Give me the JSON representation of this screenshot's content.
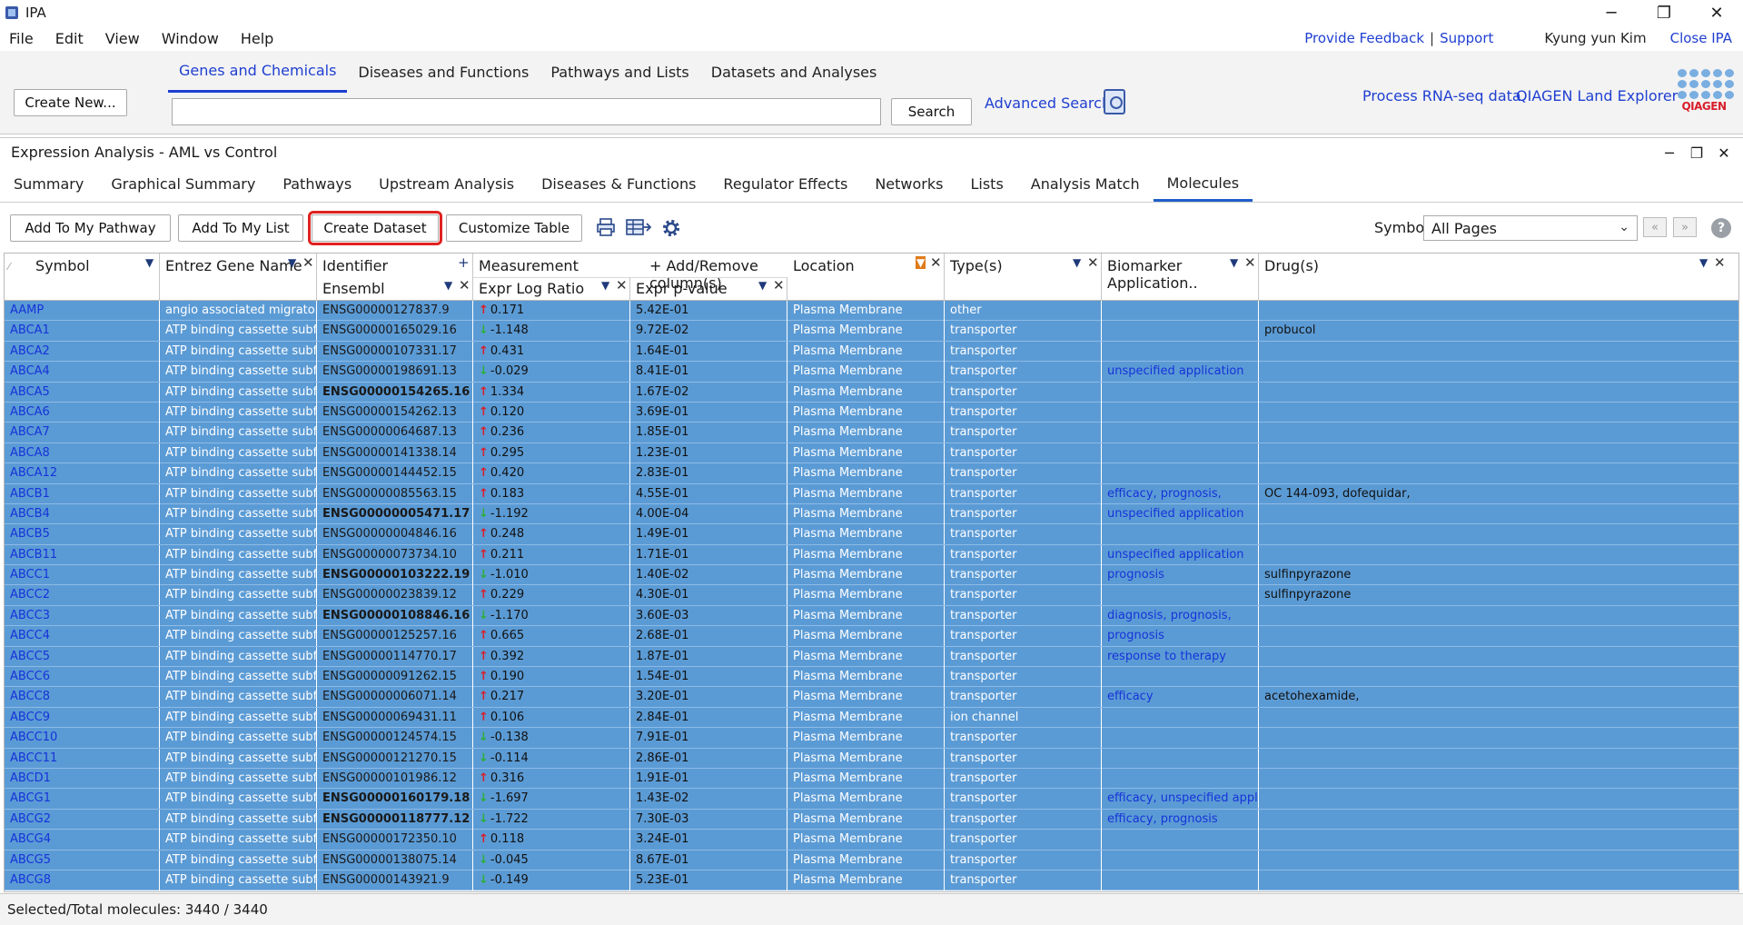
{
  "app": {
    "title": "IPA"
  },
  "window_controls": {
    "minimize": "─",
    "maximize": "❐",
    "close": "✕"
  },
  "menu": [
    "File",
    "Edit",
    "View",
    "Window",
    "Help"
  ],
  "top_links": {
    "feedback": "Provide Feedback",
    "separator": "|",
    "support": "Support",
    "user": "Kyung yun Kim",
    "close": "Close IPA"
  },
  "search": {
    "create_new": "Create New...",
    "tabs": [
      "Genes and Chemicals",
      "Diseases and Functions",
      "Pathways and Lists",
      "Datasets and Analyses"
    ],
    "active_tab": 0,
    "input_value": "",
    "button": "Search",
    "advanced": "Advanced Search",
    "rna_seq": "Process RNA-seq data",
    "land_explorer": "QIAGEN Land Explorer",
    "logo_text": "QIAGEN"
  },
  "panel": {
    "title": "Expression Analysis - AML vs Control",
    "tabs": [
      "Summary",
      "Graphical Summary",
      "Pathways",
      "Upstream Analysis",
      "Diseases & Functions",
      "Regulator Effects",
      "Networks",
      "Lists",
      "Analysis Match",
      "Molecules"
    ],
    "active_tab": "Molecules"
  },
  "toolbar": {
    "add_pathway": "Add To My Pathway",
    "add_list": "Add To My List",
    "create_dataset": "Create Dataset",
    "customize": "Customize Table",
    "symbol_label": "Symbol",
    "pages_value": "All Pages",
    "prev": "«",
    "next": "»",
    "help": "?"
  },
  "table": {
    "headers": {
      "symbol": "Symbol",
      "gene": "Entrez Gene Name",
      "identifier": "Identifier",
      "identifier_sub": "Ensembl",
      "measurement": "Measurement",
      "add_remove": "+ Add/Remove column(s)",
      "ratio_sub": "Expr Log Ratio",
      "pval_sub": "Expr p-value",
      "location": "Location",
      "type": "Type(s)",
      "biomarker": "Biomarker Application..",
      "drugs": "Drug(s)"
    },
    "rows": [
      {
        "symbol": "AAMP",
        "gene": "angio associated migratory cell ...",
        "id": "ENSG00000127837.9",
        "bold": false,
        "dir": "up",
        "ratio": "0.171",
        "pval": "5.42E-01",
        "loc": "Plasma Membrane",
        "type": "other",
        "bio": "",
        "drug": ""
      },
      {
        "symbol": "ABCA1",
        "gene": "ATP binding cassette subfamily ...",
        "id": "ENSG00000165029.16",
        "bold": false,
        "dir": "down",
        "ratio": "-1.148",
        "pval": "9.72E-02",
        "loc": "Plasma Membrane",
        "type": "transporter",
        "bio": "",
        "drug": "probucol"
      },
      {
        "symbol": "ABCA2",
        "gene": "ATP binding cassette subfamily ...",
        "id": "ENSG00000107331.17",
        "bold": false,
        "dir": "up",
        "ratio": "0.431",
        "pval": "1.64E-01",
        "loc": "Plasma Membrane",
        "type": "transporter",
        "bio": "",
        "drug": ""
      },
      {
        "symbol": "ABCA4",
        "gene": "ATP binding cassette subfamily ...",
        "id": "ENSG00000198691.13",
        "bold": false,
        "dir": "down",
        "ratio": "-0.029",
        "pval": "8.41E-01",
        "loc": "Plasma Membrane",
        "type": "transporter",
        "bio": "unspecified application",
        "drug": ""
      },
      {
        "symbol": "ABCA5",
        "gene": "ATP binding cassette subfamily ...",
        "id": "ENSG00000154265.16",
        "bold": true,
        "dir": "up",
        "ratio": "1.334",
        "pval": "1.67E-02",
        "loc": "Plasma Membrane",
        "type": "transporter",
        "bio": "",
        "drug": ""
      },
      {
        "symbol": "ABCA6",
        "gene": "ATP binding cassette subfamily ...",
        "id": "ENSG00000154262.13",
        "bold": false,
        "dir": "up",
        "ratio": "0.120",
        "pval": "3.69E-01",
        "loc": "Plasma Membrane",
        "type": "transporter",
        "bio": "",
        "drug": ""
      },
      {
        "symbol": "ABCA7",
        "gene": "ATP binding cassette subfamily ...",
        "id": "ENSG00000064687.13",
        "bold": false,
        "dir": "up",
        "ratio": "0.236",
        "pval": "1.85E-01",
        "loc": "Plasma Membrane",
        "type": "transporter",
        "bio": "",
        "drug": ""
      },
      {
        "symbol": "ABCA8",
        "gene": "ATP binding cassette subfamily ...",
        "id": "ENSG00000141338.14",
        "bold": false,
        "dir": "up",
        "ratio": "0.295",
        "pval": "1.23E-01",
        "loc": "Plasma Membrane",
        "type": "transporter",
        "bio": "",
        "drug": ""
      },
      {
        "symbol": "ABCA12",
        "gene": "ATP binding cassette subfamily ...",
        "id": "ENSG00000144452.15",
        "bold": false,
        "dir": "up",
        "ratio": "0.420",
        "pval": "2.83E-01",
        "loc": "Plasma Membrane",
        "type": "transporter",
        "bio": "",
        "drug": ""
      },
      {
        "symbol": "ABCB1",
        "gene": "ATP binding cassette subfamily ...",
        "id": "ENSG00000085563.15",
        "bold": false,
        "dir": "up",
        "ratio": "0.183",
        "pval": "4.55E-01",
        "loc": "Plasma Membrane",
        "type": "transporter",
        "bio": "efficacy,   prognosis,",
        "drug": "OC 144-093,   dofequidar,"
      },
      {
        "symbol": "ABCB4",
        "gene": "ATP binding cassette subfamily ...",
        "id": "ENSG00000005471.17",
        "bold": true,
        "dir": "down",
        "ratio": "-1.192",
        "pval": "4.00E-04",
        "loc": "Plasma Membrane",
        "type": "transporter",
        "bio": "unspecified application",
        "drug": ""
      },
      {
        "symbol": "ABCB5",
        "gene": "ATP binding cassette subfamily ...",
        "id": "ENSG00000004846.16",
        "bold": false,
        "dir": "up",
        "ratio": "0.248",
        "pval": "1.49E-01",
        "loc": "Plasma Membrane",
        "type": "transporter",
        "bio": "",
        "drug": ""
      },
      {
        "symbol": "ABCB11",
        "gene": "ATP binding cassette subfamily ...",
        "id": "ENSG00000073734.10",
        "bold": false,
        "dir": "up",
        "ratio": "0.211",
        "pval": "1.71E-01",
        "loc": "Plasma Membrane",
        "type": "transporter",
        "bio": "unspecified application",
        "drug": ""
      },
      {
        "symbol": "ABCC1",
        "gene": "ATP binding cassette subfamily ...",
        "id": "ENSG00000103222.19",
        "bold": true,
        "dir": "down",
        "ratio": "-1.010",
        "pval": "1.40E-02",
        "loc": "Plasma Membrane",
        "type": "transporter",
        "bio": "prognosis",
        "drug": "sulfinpyrazone"
      },
      {
        "symbol": "ABCC2",
        "gene": "ATP binding cassette subfamily ...",
        "id": "ENSG00000023839.12",
        "bold": false,
        "dir": "up",
        "ratio": "0.229",
        "pval": "4.30E-01",
        "loc": "Plasma Membrane",
        "type": "transporter",
        "bio": "",
        "drug": "sulfinpyrazone"
      },
      {
        "symbol": "ABCC3",
        "gene": "ATP binding cassette subfamily ...",
        "id": "ENSG00000108846.16",
        "bold": true,
        "dir": "down",
        "ratio": "-1.170",
        "pval": "3.60E-03",
        "loc": "Plasma Membrane",
        "type": "transporter",
        "bio": "diagnosis,   prognosis,",
        "drug": ""
      },
      {
        "symbol": "ABCC4",
        "gene": "ATP binding cassette subfamily ...",
        "id": "ENSG00000125257.16",
        "bold": false,
        "dir": "up",
        "ratio": "0.665",
        "pval": "2.68E-01",
        "loc": "Plasma Membrane",
        "type": "transporter",
        "bio": "prognosis",
        "drug": ""
      },
      {
        "symbol": "ABCC5",
        "gene": "ATP binding cassette subfamily ...",
        "id": "ENSG00000114770.17",
        "bold": false,
        "dir": "up",
        "ratio": "0.392",
        "pval": "1.87E-01",
        "loc": "Plasma Membrane",
        "type": "transporter",
        "bio": "response to therapy",
        "drug": ""
      },
      {
        "symbol": "ABCC6",
        "gene": "ATP binding cassette subfamily ...",
        "id": "ENSG00000091262.15",
        "bold": false,
        "dir": "up",
        "ratio": "0.190",
        "pval": "1.54E-01",
        "loc": "Plasma Membrane",
        "type": "transporter",
        "bio": "",
        "drug": ""
      },
      {
        "symbol": "ABCC8",
        "gene": "ATP binding cassette subfamily ...",
        "id": "ENSG00000006071.14",
        "bold": false,
        "dir": "up",
        "ratio": "0.217",
        "pval": "3.20E-01",
        "loc": "Plasma Membrane",
        "type": "transporter",
        "bio": "efficacy",
        "drug": "acetohexamide,"
      },
      {
        "symbol": "ABCC9",
        "gene": "ATP binding cassette subfamily ...",
        "id": "ENSG00000069431.11",
        "bold": false,
        "dir": "up",
        "ratio": "0.106",
        "pval": "2.84E-01",
        "loc": "Plasma Membrane",
        "type": "ion channel",
        "bio": "",
        "drug": ""
      },
      {
        "symbol": "ABCC10",
        "gene": "ATP binding cassette subfamily ...",
        "id": "ENSG00000124574.15",
        "bold": false,
        "dir": "down",
        "ratio": "-0.138",
        "pval": "7.91E-01",
        "loc": "Plasma Membrane",
        "type": "transporter",
        "bio": "",
        "drug": ""
      },
      {
        "symbol": "ABCC11",
        "gene": "ATP binding cassette subfamily ...",
        "id": "ENSG00000121270.15",
        "bold": false,
        "dir": "down",
        "ratio": "-0.114",
        "pval": "2.86E-01",
        "loc": "Plasma Membrane",
        "type": "transporter",
        "bio": "",
        "drug": ""
      },
      {
        "symbol": "ABCD1",
        "gene": "ATP binding cassette subfamily ...",
        "id": "ENSG00000101986.12",
        "bold": false,
        "dir": "up",
        "ratio": "0.316",
        "pval": "1.91E-01",
        "loc": "Plasma Membrane",
        "type": "transporter",
        "bio": "",
        "drug": ""
      },
      {
        "symbol": "ABCG1",
        "gene": "ATP binding cassette subfamily ...",
        "id": "ENSG00000160179.18",
        "bold": true,
        "dir": "down",
        "ratio": "-1.697",
        "pval": "1.43E-02",
        "loc": "Plasma Membrane",
        "type": "transporter",
        "bio": "efficacy,   unspecified application",
        "drug": ""
      },
      {
        "symbol": "ABCG2",
        "gene": "ATP binding cassette subfamily ...",
        "id": "ENSG00000118777.12",
        "bold": true,
        "dir": "down",
        "ratio": "-1.722",
        "pval": "7.30E-03",
        "loc": "Plasma Membrane",
        "type": "transporter",
        "bio": "efficacy,   prognosis",
        "drug": ""
      },
      {
        "symbol": "ABCG4",
        "gene": "ATP binding cassette subfamily ...",
        "id": "ENSG00000172350.10",
        "bold": false,
        "dir": "up",
        "ratio": "0.118",
        "pval": "3.24E-01",
        "loc": "Plasma Membrane",
        "type": "transporter",
        "bio": "",
        "drug": ""
      },
      {
        "symbol": "ABCG5",
        "gene": "ATP binding cassette subfamily ...",
        "id": "ENSG00000138075.14",
        "bold": false,
        "dir": "down",
        "ratio": "-0.045",
        "pval": "8.67E-01",
        "loc": "Plasma Membrane",
        "type": "transporter",
        "bio": "",
        "drug": ""
      },
      {
        "symbol": "ABCG8",
        "gene": "ATP binding cassette subfamily ...",
        "id": "ENSG00000143921.9",
        "bold": false,
        "dir": "down",
        "ratio": "-0.149",
        "pval": "5.23E-01",
        "loc": "Plasma Membrane",
        "type": "transporter",
        "bio": "",
        "drug": ""
      }
    ]
  },
  "status": {
    "text": "Selected/Total molecules: 3440 / 3440"
  },
  "colors": {
    "selected_row": "#5b9bd5",
    "link": "#1f3fd1",
    "highlight": "#e0211f",
    "up_arrow": "#d81e2b",
    "down_arrow": "#2eae3c"
  },
  "icons": {
    "print": "printer-icon",
    "export": "export-table-icon",
    "settings": "gear-icon",
    "advanced_search": "advanced-search-icon"
  }
}
